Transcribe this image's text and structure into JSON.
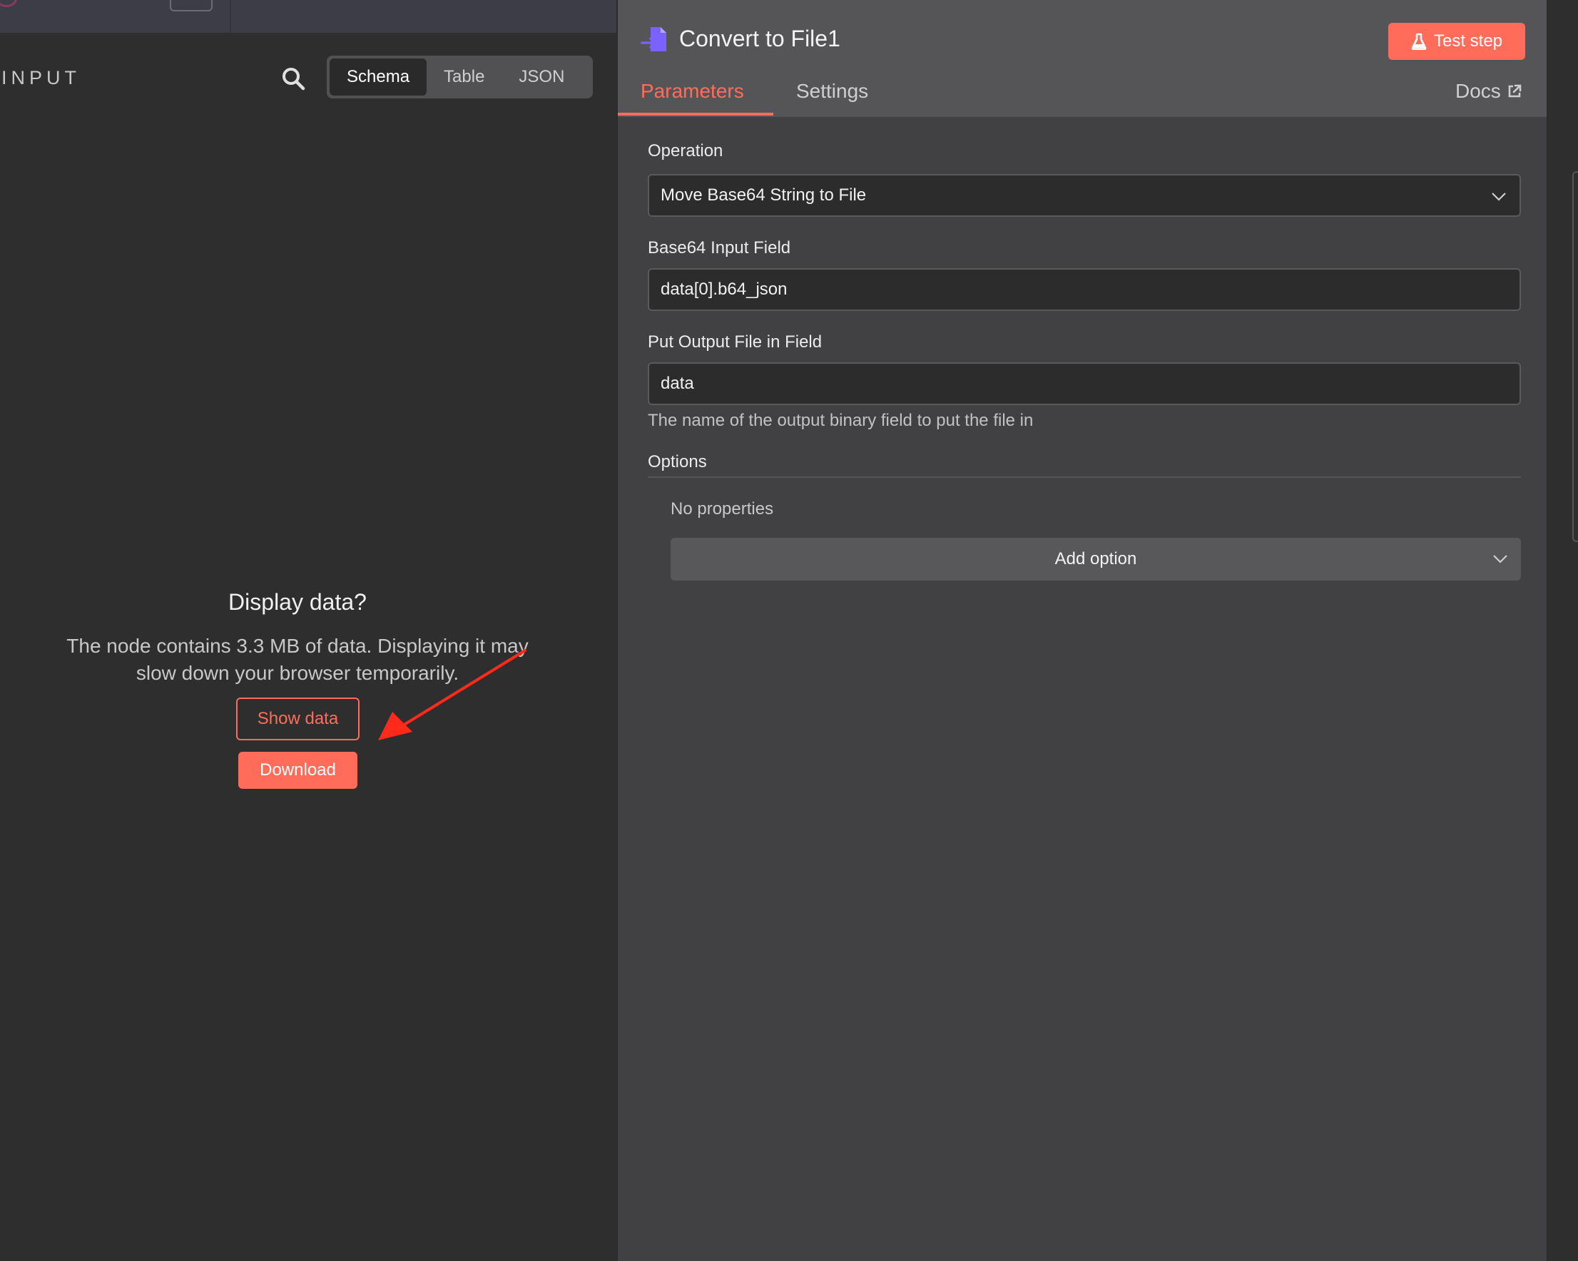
{
  "input_panel": {
    "title": "INPUT",
    "view_tabs": [
      "Schema",
      "Table",
      "JSON"
    ],
    "active_tab": "Schema",
    "display_title": "Display data?",
    "display_text": "The node contains 3.3 MB of data. Displaying it may slow down your browser temporarily.",
    "show_data_label": "Show data",
    "download_label": "Download"
  },
  "node": {
    "title": "Convert to File1",
    "test_step_label": "Test step",
    "tabs": [
      "Parameters",
      "Settings"
    ],
    "active_tab": "Parameters",
    "docs_label": "Docs",
    "operation": {
      "label": "Operation",
      "value": "Move Base64 String to File"
    },
    "base64_field": {
      "label": "Base64 Input Field",
      "value": "data[0].b64_json"
    },
    "output_field": {
      "label": "Put Output File in Field",
      "value": "data",
      "hint": "The name of the output binary field to put the file in"
    },
    "options": {
      "label": "Options",
      "empty_text": "No properties",
      "add_option_label": "Add option"
    }
  },
  "colors": {
    "accent": "#ff6d5a",
    "node_icon": "#7b61ff",
    "panel_bg": "#414143",
    "input_bg": "#2e2e2f"
  }
}
